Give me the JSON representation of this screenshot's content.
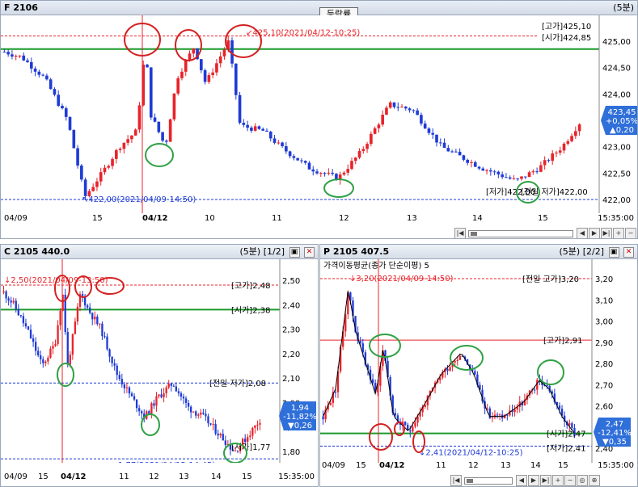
{
  "top": {
    "title": "F 2106",
    "interval": "(5분)",
    "tab": "등락률",
    "annot_high": "425,10(2021/04/12-10:25)",
    "annot_low": "422,00(2021/04/09-14:50)",
    "label_high": "[고가]425,10",
    "label_open": "[시가]424,85",
    "label_low": "[저가]422,00",
    "label_prevlow": "[전일 저가]422,00",
    "price_labels": [
      "425,00",
      "424,50",
      "424,00",
      "423,50",
      "423,00",
      "422,50",
      "422,00"
    ],
    "cur_price": "423,45",
    "cur_pct": "+0,05%",
    "cur_chg": "▲0,20",
    "xticks": [
      "04/09",
      "15",
      "04/12",
      "10",
      "11",
      "12",
      "13",
      "14",
      "15"
    ],
    "time": "15:35:00"
  },
  "bl": {
    "title": "C 2105 440.0",
    "interval": "(5분)",
    "page": "[1/2]",
    "annot_high": "2,50(2021/04/09-13:50)",
    "annot_low": "1,77(2021/04/12-14:45)",
    "label_high": "[고가]2,48",
    "label_open": "[시가]2,38",
    "label_prevlow": "[전일 저가]2,08",
    "label_low": "[저가]1,77",
    "price_labels": [
      "2,50",
      "2,40",
      "2,30",
      "2,20",
      "2,10",
      "2,00",
      "1,90",
      "1,80"
    ],
    "cur_price": "1,94",
    "cur_pct": "-11,82%",
    "cur_chg": "▼0,26",
    "xticks": [
      "04/09",
      "15",
      "04/12",
      "11",
      "12",
      "13",
      "14",
      "15"
    ],
    "time": "15:35:00"
  },
  "br": {
    "title": "P 2105 407.5",
    "interval": "(5분)",
    "page": "[2/2]",
    "ma_label": "가격이동평균(종가 단순이평) 5",
    "annot_high": "3,20(2021/04/09-14:50)",
    "annot_low": "2,41(2021/04/12-10:25)",
    "label_prevhigh": "[전일 고가]3,20",
    "label_high": "[고가]2,91",
    "label_open": "[시가]2,47",
    "label_low": "[저가]2,41",
    "price_labels": [
      "3,20",
      "3,10",
      "3,00",
      "2,90",
      "2,80",
      "2,70",
      "2,60",
      "2,50",
      "2,40"
    ],
    "cur_price": "2,47",
    "cur_pct": "-12,41%",
    "cur_chg": "▼0,35",
    "xticks": [
      "04/09",
      "15",
      "04/12",
      "11",
      "12",
      "13",
      "14",
      "15"
    ],
    "time": "15:35:00"
  },
  "colors": {
    "up": "#e8232a",
    "down": "#1f3bd6",
    "open_line": "#1a9a2a",
    "annot": "#e8232a",
    "marker_red": "#d42020",
    "marker_green": "#2ea043",
    "badge": "#2f6fd9"
  }
}
